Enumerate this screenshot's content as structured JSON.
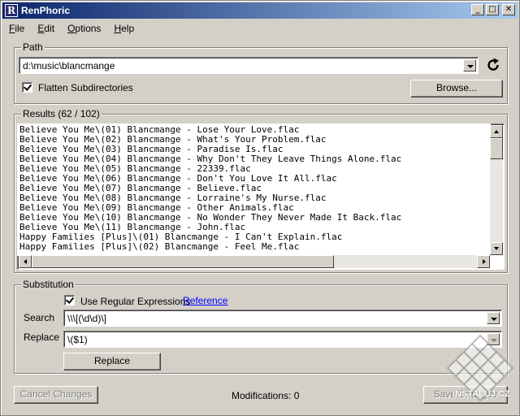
{
  "window": {
    "title": "RenPhoric",
    "icon_letter": "R",
    "min": "_",
    "max": "□",
    "close": "✕"
  },
  "menu": [
    {
      "label": "File",
      "mnemonic": "F",
      "rest": "ile"
    },
    {
      "label": "Edit",
      "mnemonic": "E",
      "rest": "dit"
    },
    {
      "label": "Options",
      "mnemonic": "O",
      "rest": "ptions"
    },
    {
      "label": "Help",
      "mnemonic": "H",
      "rest": "elp"
    }
  ],
  "path": {
    "group_label": "Path",
    "value": "d:\\music\\blancmange",
    "flatten_label": "Flatten Subdirectories",
    "flatten_checked": true,
    "browse_label": "Browse..."
  },
  "results": {
    "group_label": "Results (62 / 102)",
    "rows": [
      "Believe You Me\\(01) Blancmange - Lose Your Love.flac",
      "Believe You Me\\(02) Blancmange - What's Your Problem.flac",
      "Believe You Me\\(03) Blancmange - Paradise Is.flac",
      "Believe You Me\\(04) Blancmange - Why Don't They Leave Things Alone.flac",
      "Believe You Me\\(05) Blancmange - 22339.flac",
      "Believe You Me\\(06) Blancmange - Don't You Love It All.flac",
      "Believe You Me\\(07) Blancmange - Believe.flac",
      "Believe You Me\\(08) Blancmange - Lorraine's My Nurse.flac",
      "Believe You Me\\(09) Blancmange - Other Animals.flac",
      "Believe You Me\\(10) Blancmange - No Wonder They Never Made It Back.flac",
      "Believe You Me\\(11) Blancmange - John.flac",
      "Happy Families [Plus]\\(01) Blancmange - I Can't Explain.flac",
      "Happy Families [Plus]\\(02) Blancmange - Feel Me.flac"
    ]
  },
  "substitution": {
    "group_label": "Substitution",
    "regex_label": "Use Regular Expressions",
    "regex_checked": true,
    "reference_link": "Reference",
    "search_label": "Search",
    "search_value": "\\\\\\[(\\d\\d)\\]",
    "replace_label": "Replace",
    "replace_value": "\\($1)",
    "replace_button": "Replace"
  },
  "footer": {
    "cancel_label": "Cancel Changes",
    "modifications": "Modifications: 0",
    "save_label": "Save Changes"
  },
  "watermark": "INSTALUJ.CZ",
  "colors": {
    "title_start": "#0a246a",
    "title_end": "#a6caf0",
    "link": "#0000ff",
    "face": "#d4d0c8"
  }
}
